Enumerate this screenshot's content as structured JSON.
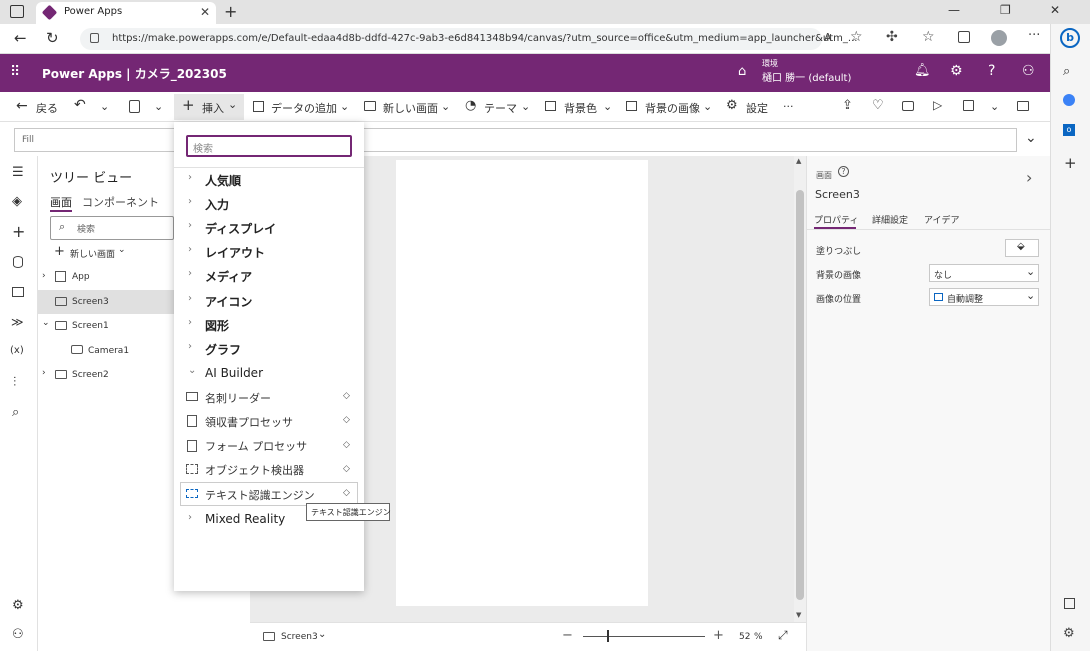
{
  "browser": {
    "tab_title": "Power Apps",
    "tab_close": "✕",
    "new_tab": "+",
    "window_controls": [
      "—",
      "❐",
      "✕"
    ],
    "url": "https://make.powerapps.com/e/Default-edaa4d8b-ddfd-427c-9ab3-e6d841348b94/canvas/?utm_source=office&utm_medium=app_launcher&utm_...",
    "read_aloud": "Aᴬ"
  },
  "app_header": {
    "title": "Power Apps | カメラ_202305",
    "env_label": "環境",
    "env_name": "樋口 勝一 (default)"
  },
  "command_bar": {
    "back": "戻る",
    "insert": "挿入",
    "add_data": "データの追加",
    "new_screen": "新しい画面",
    "theme": "テーマ",
    "background_color": "背景色",
    "background_image": "背景の画像",
    "settings": "設定",
    "more": "···"
  },
  "formula_bar": {
    "property": "Fill"
  },
  "tree_view": {
    "title": "ツリー ビュー",
    "tab_screens": "画面",
    "tab_components": "コンポーネント",
    "search_placeholder": "検索",
    "new_screen": "新しい画面",
    "nodes": {
      "app": "App",
      "screen3": "Screen3",
      "screen1": "Screen1",
      "camera1": "Camera1",
      "screen2": "Screen2"
    }
  },
  "insert_menu": {
    "search_placeholder": "検索",
    "categories": [
      "人気順",
      "入力",
      "ディスプレイ",
      "レイアウト",
      "メディア",
      "アイコン",
      "図形",
      "グラフ"
    ],
    "ai_builder": "AI Builder",
    "ai_items": [
      "名刺リーダー",
      "領収書プロセッサ",
      "フォーム プロセッサ",
      "オブジェクト検出器",
      "テキスト認識エンジン"
    ],
    "mixed_reality": "Mixed Reality",
    "tooltip": "テキスト認識エンジン"
  },
  "status_bar": {
    "screen": "Screen3",
    "zoom_minus": "−",
    "zoom_plus": "+",
    "zoom": "52",
    "zoom_unit": "%",
    "zoom_level": 0.52
  },
  "properties": {
    "kind": "画面",
    "name": "Screen3",
    "tab_properties": "プロパティ",
    "tab_advanced": "詳細設定",
    "tab_ideas": "アイデア",
    "fill_label": "塗りつぶし",
    "bg_image_label": "背景の画像",
    "bg_image_value": "なし",
    "image_position_label": "画像の位置",
    "image_position_value": "自動調整"
  },
  "colors": {
    "brand": "#742774",
    "canvas": "#ebebeb",
    "edge_blue": "#0a66c2"
  }
}
